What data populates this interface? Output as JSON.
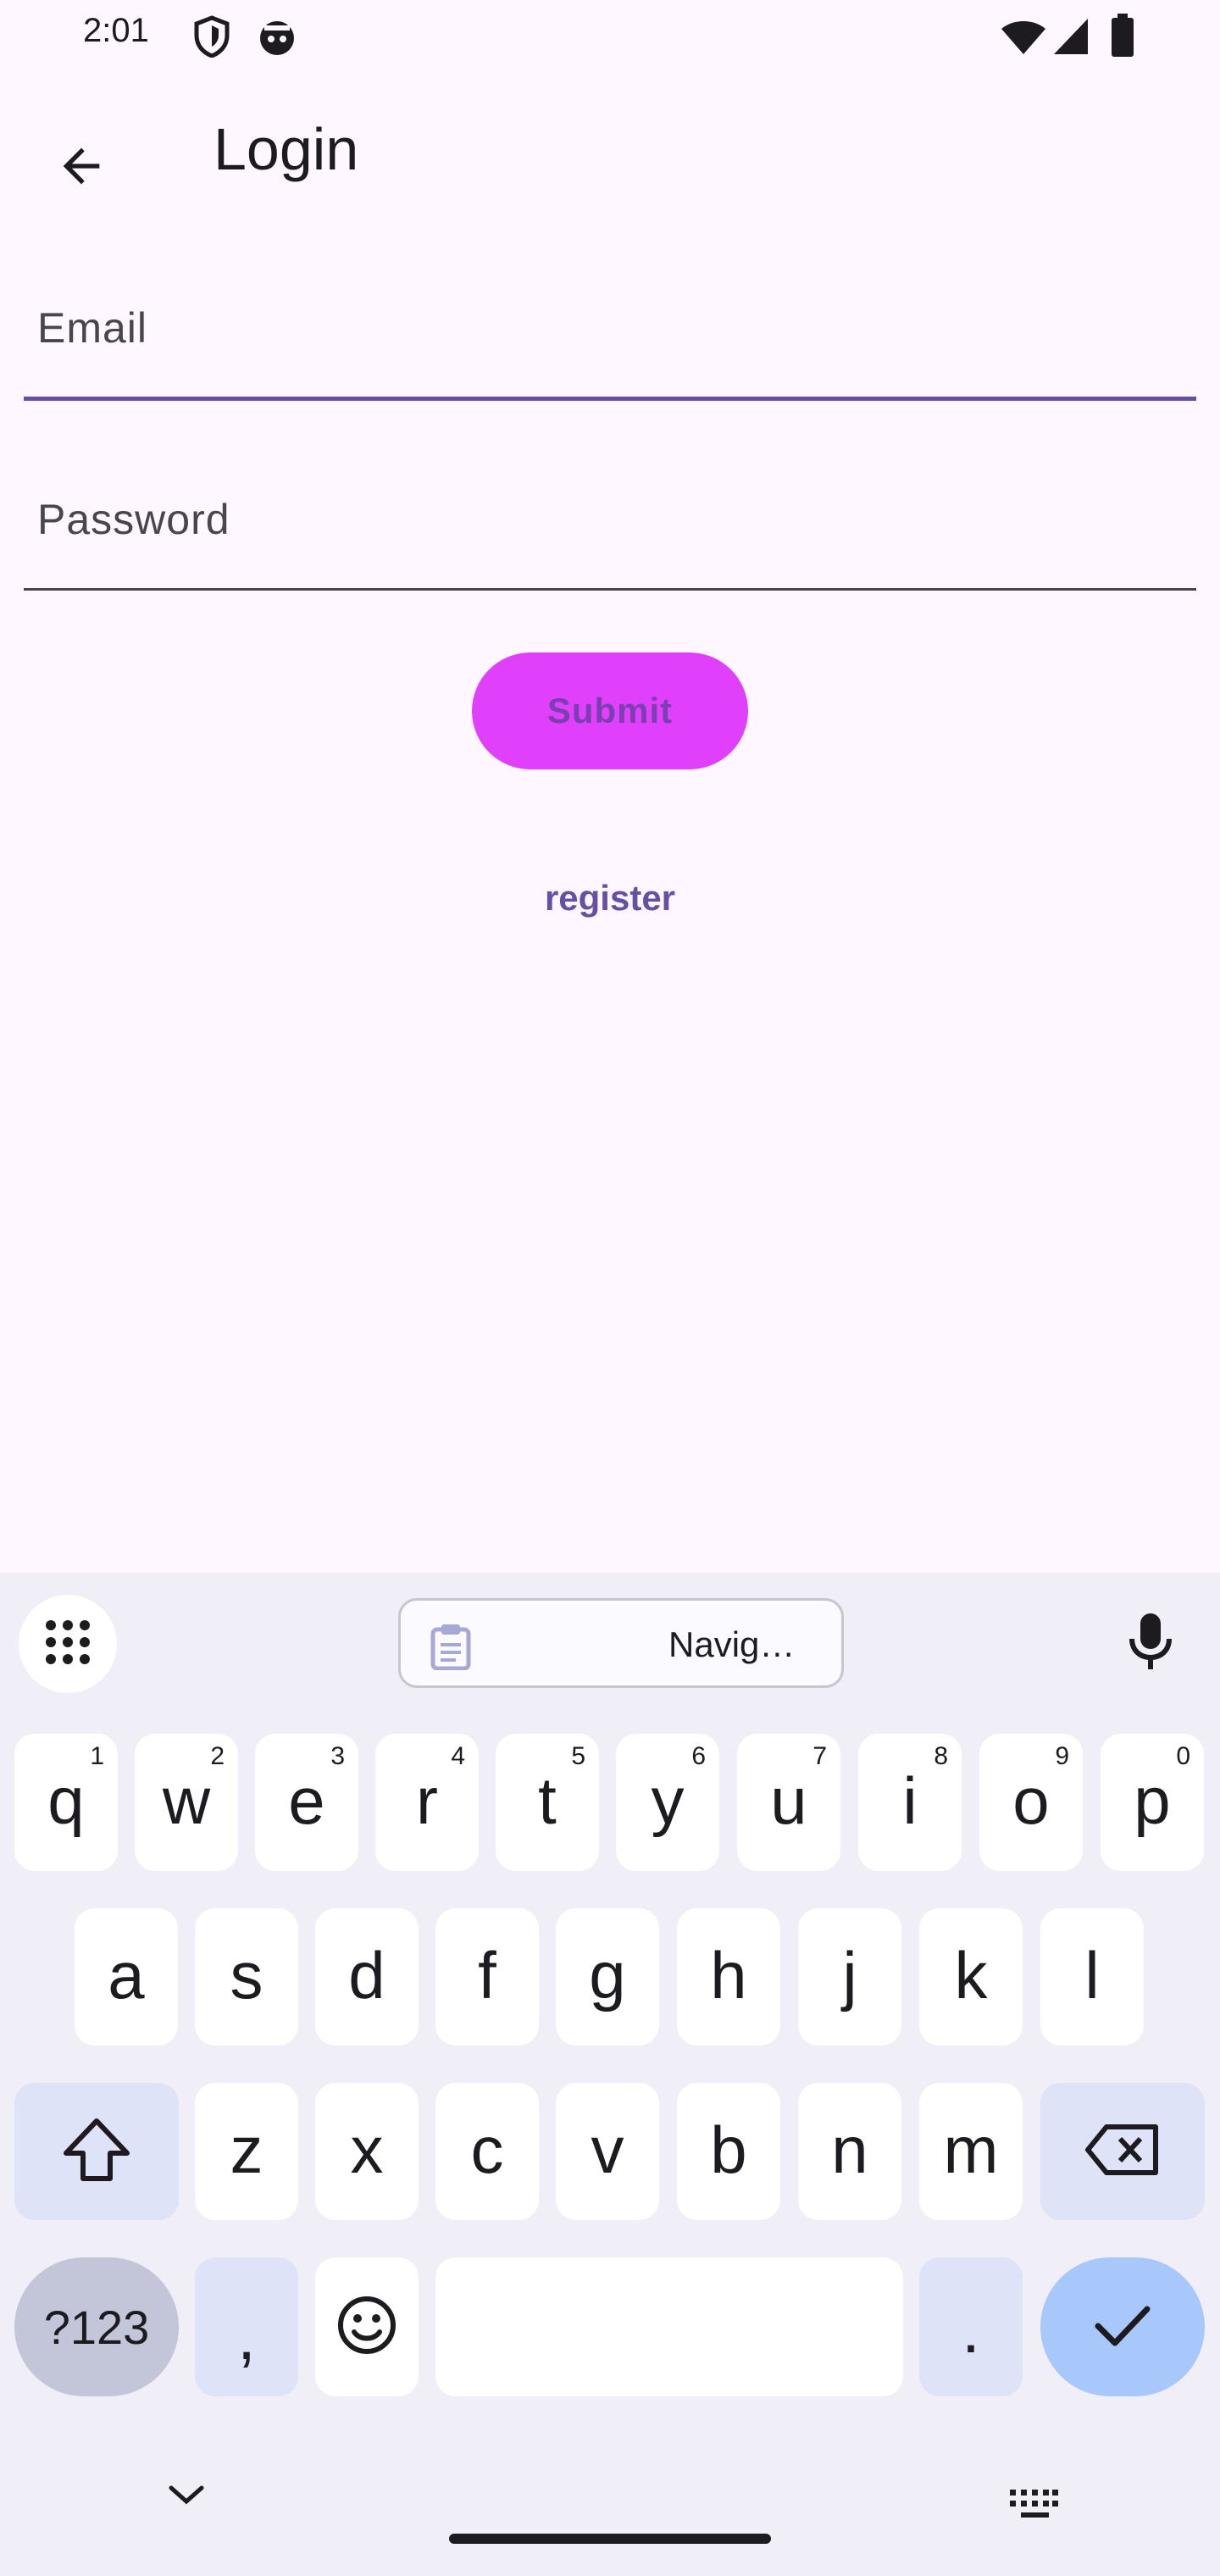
{
  "status_bar": {
    "time": "2:01",
    "icons": [
      "vpn-shield-icon",
      "android-face-icon",
      "wifi-icon",
      "signal-icon",
      "battery-icon"
    ]
  },
  "app_bar": {
    "back_icon": "arrow-back-icon",
    "title": "Login"
  },
  "form": {
    "email": {
      "label": "Email",
      "value": "",
      "focused": true
    },
    "password": {
      "label": "Password",
      "value": ""
    },
    "submit_label": "Submit",
    "register_label": "register"
  },
  "colors": {
    "background": "#fef7ff",
    "focus_underline": "#6750a4",
    "submit_bg": "#e040fb",
    "submit_text": "#7b3fb0",
    "link": "#6750a4"
  },
  "keyboard": {
    "toolbar": {
      "apps_icon": "grid-icon",
      "clipboard_icon": "clipboard-icon",
      "suggestion": "Navig…",
      "mic_icon": "mic-icon"
    },
    "row1": [
      {
        "key": "q",
        "hint": "1"
      },
      {
        "key": "w",
        "hint": "2"
      },
      {
        "key": "e",
        "hint": "3"
      },
      {
        "key": "r",
        "hint": "4"
      },
      {
        "key": "t",
        "hint": "5"
      },
      {
        "key": "y",
        "hint": "6"
      },
      {
        "key": "u",
        "hint": "7"
      },
      {
        "key": "i",
        "hint": "8"
      },
      {
        "key": "o",
        "hint": "9"
      },
      {
        "key": "p",
        "hint": "0"
      }
    ],
    "row2": [
      "a",
      "s",
      "d",
      "f",
      "g",
      "h",
      "j",
      "k",
      "l"
    ],
    "row3": [
      "z",
      "x",
      "c",
      "v",
      "b",
      "n",
      "m"
    ],
    "row4": {
      "symbols": "?123",
      "comma": ",",
      "period": ".",
      "emoji_icon": "emoji-icon",
      "enter_icon": "check-icon",
      "shift_icon": "shift-icon",
      "backspace_icon": "backspace-icon"
    },
    "nav": {
      "hide_icon": "chevron-down-icon",
      "switch_icon": "keyboard-icon"
    }
  }
}
